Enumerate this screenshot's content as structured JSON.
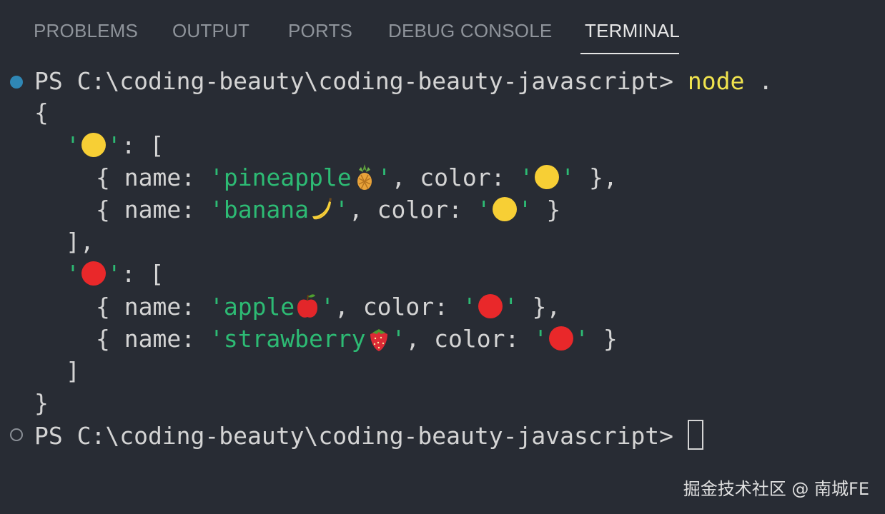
{
  "tabs": [
    {
      "label": "PROBLEMS",
      "active": false
    },
    {
      "label": "OUTPUT",
      "active": false
    },
    {
      "label": "PORTS",
      "active": false
    },
    {
      "label": "DEBUG CONSOLE",
      "active": false
    },
    {
      "label": "TERMINAL",
      "active": true
    }
  ],
  "terminal": {
    "prompt": "PS C:\\coding-beauty\\coding-beauty-javascript>",
    "command_name": "node",
    "command_arg": ".",
    "output": {
      "open_brace": "{",
      "close_brace": "}",
      "groups": [
        {
          "key_emoji": "yellow-circle",
          "items": [
            {
              "name": "pineapple",
              "name_emoji": "pineapple",
              "color_emoji": "yellow-circle"
            },
            {
              "name": "banana",
              "name_emoji": "banana",
              "color_emoji": "yellow-circle"
            }
          ]
        },
        {
          "key_emoji": "red-circle",
          "items": [
            {
              "name": "apple",
              "name_emoji": "apple",
              "color_emoji": "red-circle"
            },
            {
              "name": "strawberry",
              "name_emoji": "strawberry",
              "color_emoji": "red-circle"
            }
          ]
        }
      ]
    }
  },
  "watermark": "掘金技术社区 @ 南城FE",
  "colors": {
    "background": "#282c34",
    "string": "#2dbb74",
    "command": "#f0e34e",
    "text": "#d4d4d4",
    "yellow_circle": "#f7cf35",
    "red_circle": "#e9282a"
  }
}
